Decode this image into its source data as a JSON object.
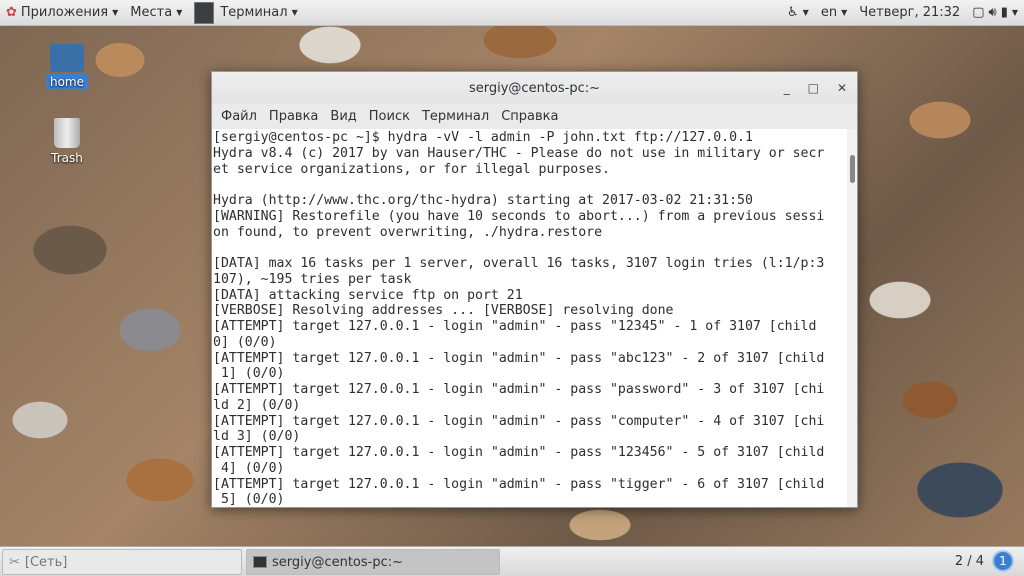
{
  "topbar": {
    "apps": "Приложения",
    "places": "Места",
    "terminal": "Терминал",
    "lang": "en",
    "clock": "Четверг, 21:32"
  },
  "desktop": {
    "home": "home",
    "trash": "Trash"
  },
  "window": {
    "title": "sergiy@centos-pc:~",
    "menu": [
      "Файл",
      "Правка",
      "Вид",
      "Поиск",
      "Терминал",
      "Справка"
    ],
    "lines": [
      "[sergiy@centos-pc ~]$ hydra -vV -l admin -P john.txt ftp://127.0.0.1",
      "Hydra v8.4 (c) 2017 by van Hauser/THC - Please do not use in military or secr",
      "et service organizations, or for illegal purposes.",
      "",
      "Hydra (http://www.thc.org/thc-hydra) starting at 2017-03-02 21:31:50",
      "[WARNING] Restorefile (you have 10 seconds to abort...) from a previous sessi",
      "on found, to prevent overwriting, ./hydra.restore",
      "",
      "[DATA] max 16 tasks per 1 server, overall 16 tasks, 3107 login tries (l:1/p:3",
      "107), ~195 tries per task",
      "[DATA] attacking service ftp on port 21",
      "[VERBOSE] Resolving addresses ... [VERBOSE] resolving done",
      "[ATTEMPT] target 127.0.0.1 - login \"admin\" - pass \"12345\" - 1 of 3107 [child",
      "0] (0/0)",
      "[ATTEMPT] target 127.0.0.1 - login \"admin\" - pass \"abc123\" - 2 of 3107 [child",
      " 1] (0/0)",
      "[ATTEMPT] target 127.0.0.1 - login \"admin\" - pass \"password\" - 3 of 3107 [chi",
      "ld 2] (0/0)",
      "[ATTEMPT] target 127.0.0.1 - login \"admin\" - pass \"computer\" - 4 of 3107 [chi",
      "ld 3] (0/0)",
      "[ATTEMPT] target 127.0.0.1 - login \"admin\" - pass \"123456\" - 5 of 3107 [child",
      " 4] (0/0)",
      "[ATTEMPT] target 127.0.0.1 - login \"admin\" - pass \"tigger\" - 6 of 3107 [child",
      " 5] (0/0)"
    ]
  },
  "taskbar": {
    "net": "[Сеть]",
    "term": "sergiy@centos-pc:~",
    "workspace": "2 / 4",
    "badge": "1"
  }
}
